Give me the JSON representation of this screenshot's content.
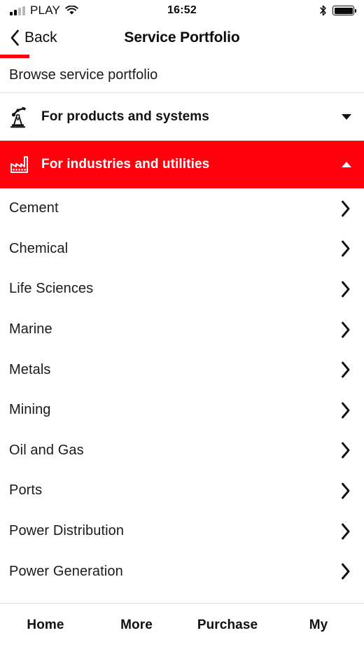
{
  "status_bar": {
    "carrier": "PLAY",
    "time": "16:52",
    "icons": {
      "signal": "signal-bars-icon",
      "wifi": "wifi-icon",
      "bluetooth": "bluetooth-icon",
      "battery": "battery-full-icon"
    },
    "battery_level": 100
  },
  "nav": {
    "back_label": "Back",
    "title": "Service Portfolio"
  },
  "progress": {
    "percent": 8,
    "color": "#FF000D"
  },
  "section": {
    "title": "Browse service portfolio"
  },
  "accordions": [
    {
      "label": "For products and systems",
      "icon": "robot-arm-icon",
      "caret": "chevron-down-icon",
      "expanded": false
    },
    {
      "label": "For industries and utilities",
      "icon": "factory-icon",
      "caret": "chevron-up-icon",
      "expanded": true
    }
  ],
  "industries": [
    {
      "label": "Cement"
    },
    {
      "label": "Chemical"
    },
    {
      "label": "Life Sciences"
    },
    {
      "label": "Marine"
    },
    {
      "label": "Metals"
    },
    {
      "label": "Mining"
    },
    {
      "label": "Oil and Gas"
    },
    {
      "label": "Ports"
    },
    {
      "label": "Power Distribution"
    },
    {
      "label": "Power Generation"
    }
  ],
  "tabs": [
    {
      "label": "Home"
    },
    {
      "label": "More"
    },
    {
      "label": "Purchase"
    },
    {
      "label": "My"
    }
  ],
  "colors": {
    "accent": "#FF000D",
    "text": "#1a1a1a",
    "divider": "#e3e3e3"
  }
}
